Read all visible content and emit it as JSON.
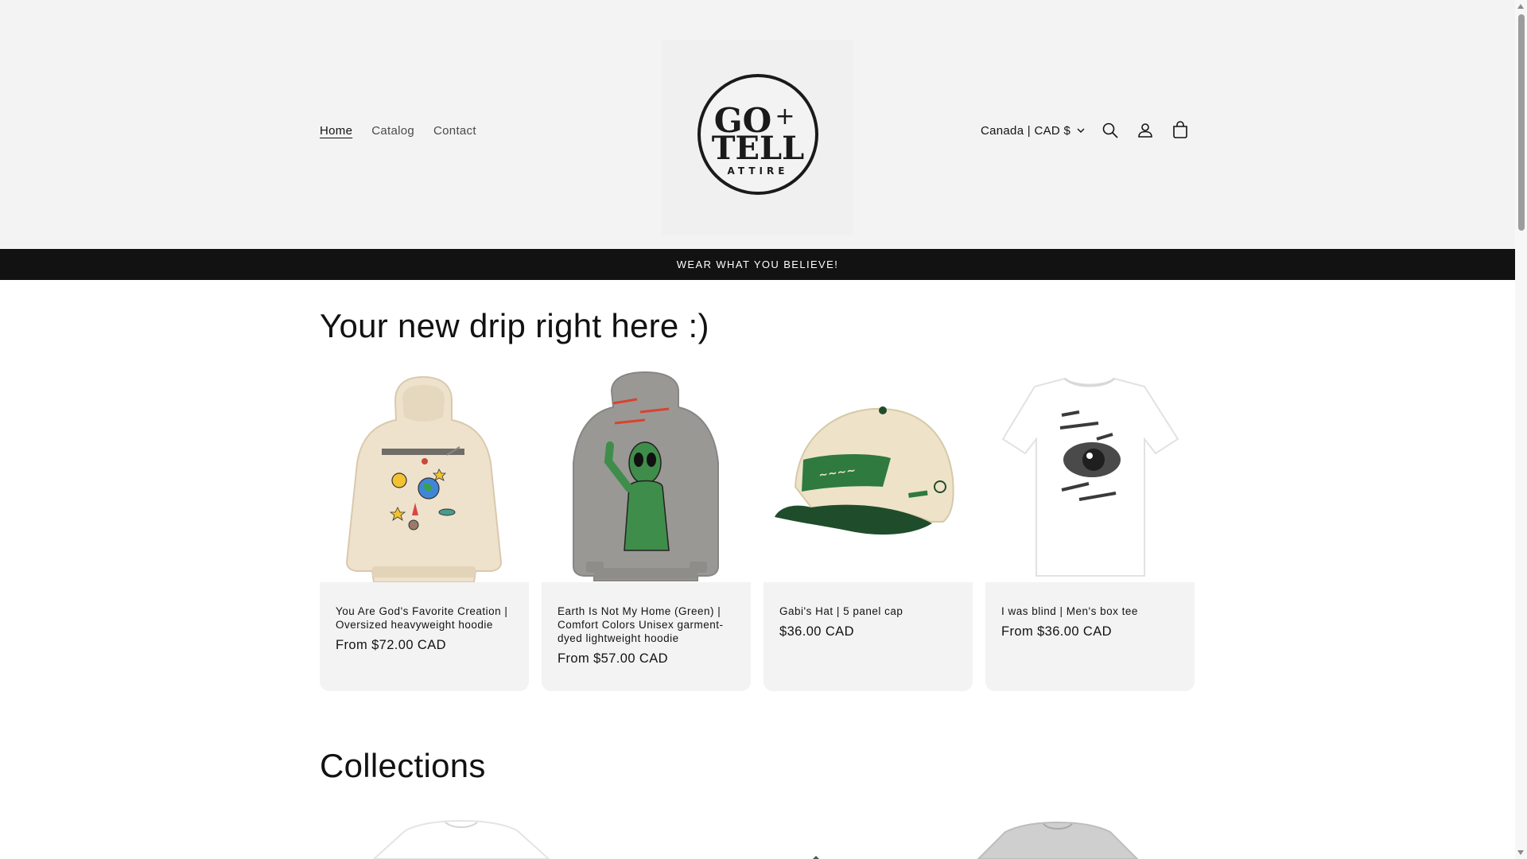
{
  "nav": {
    "items": [
      "Home",
      "Catalog",
      "Contact"
    ]
  },
  "logo": {
    "line1": "GO",
    "plus": "+",
    "line2": "TELL",
    "line3": "ATTIRE"
  },
  "header": {
    "country_label": "Canada | CAD $"
  },
  "icons": [
    "search-icon",
    "account-icon",
    "cart-icon",
    "chevron-down-icon"
  ],
  "announcement": "WEAR WHAT YOU BELIEVE!",
  "featured": {
    "title": "Your new drip right here :)",
    "products": [
      {
        "title": "You Are God's Favorite Creation | Oversized heavyweight hoodie",
        "price": "From $72.00 CAD"
      },
      {
        "title": "Earth Is Not My Home (Green) | Comfort Colors Unisex garment-dyed lightweight hoodie",
        "price": "From $57.00 CAD"
      },
      {
        "title": "Gabi's Hat | 5 panel cap",
        "price": "$36.00 CAD"
      },
      {
        "title": "I was blind | Men's box tee",
        "price": "From $36.00 CAD"
      }
    ]
  },
  "collections": {
    "title": "Collections"
  },
  "colors": {
    "header_bg": "#f3f3f3",
    "announce_bg": "#121212",
    "card_bg": "#f3f3f3"
  }
}
